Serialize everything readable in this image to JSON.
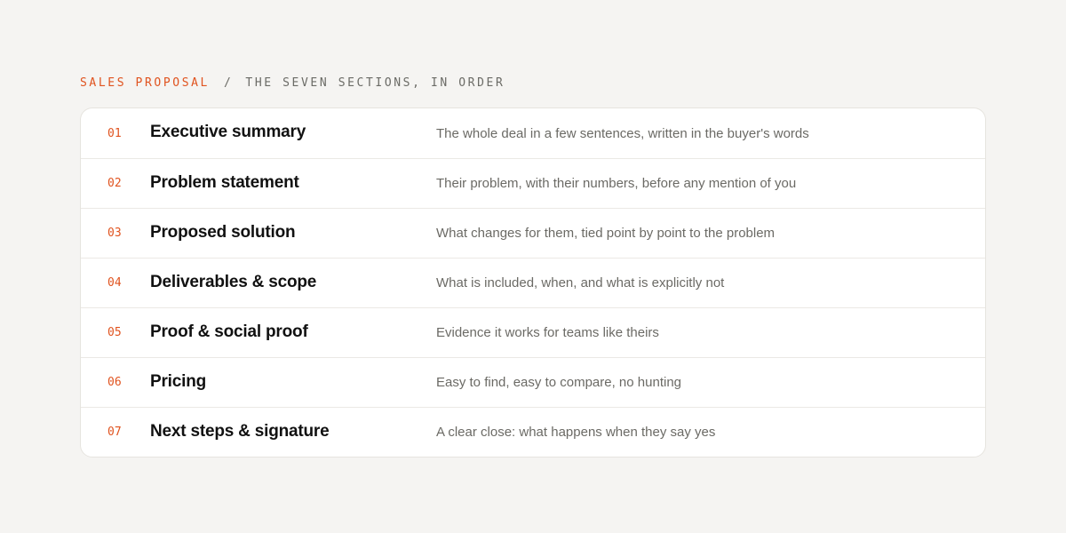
{
  "header": {
    "label": "SALES PROPOSAL",
    "separator": "/",
    "subtitle": "THE SEVEN SECTIONS, IN ORDER"
  },
  "sections": [
    {
      "number": "01",
      "title": "Executive summary",
      "description": "The whole deal in a few sentences, written in the buyer's words"
    },
    {
      "number": "02",
      "title": "Problem statement",
      "description": "Their problem, with their numbers, before any mention of you"
    },
    {
      "number": "03",
      "title": "Proposed solution",
      "description": "What changes for them, tied point by point to the problem"
    },
    {
      "number": "04",
      "title": "Deliverables & scope",
      "description": "What is included, when, and what is explicitly not"
    },
    {
      "number": "05",
      "title": "Proof & social proof",
      "description": "Evidence it works for teams like theirs"
    },
    {
      "number": "06",
      "title": "Pricing",
      "description": "Easy to find, easy to compare, no hunting"
    },
    {
      "number": "07",
      "title": "Next steps & signature",
      "description": "A clear close: what happens when they say yes"
    }
  ],
  "colors": {
    "accent": "#e0531f",
    "background": "#f5f4f2",
    "card": "#ffffff",
    "muted_text": "#6b6a65"
  }
}
